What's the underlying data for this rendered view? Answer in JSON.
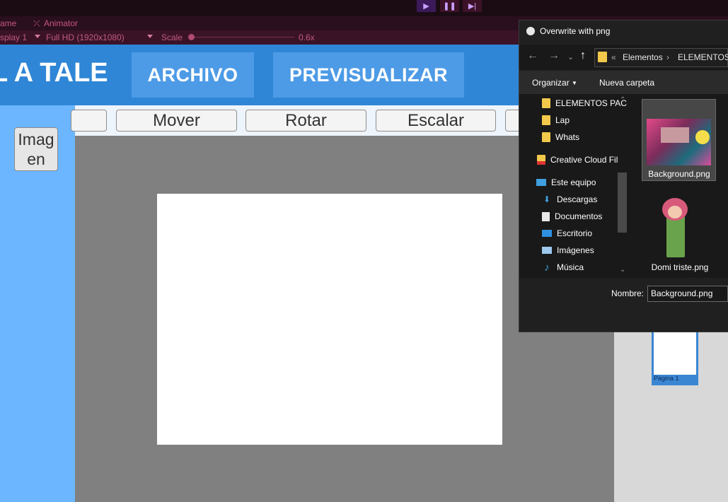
{
  "editor": {
    "tabs": [
      "ame",
      "Animator"
    ],
    "display": "splay 1",
    "resolution": "Full HD (1920x1080)",
    "scale_label": "Scale",
    "scale_value": "0.6x",
    "play_controls": [
      "play-icon",
      "pause-icon",
      "step-icon"
    ]
  },
  "app": {
    "title": "L A TALE",
    "archivo_label": "ARCHIVO",
    "preview_label": "PREVISUALIZAR",
    "image_button": "Imag en",
    "tools": [
      "Mover",
      "Rotar",
      "Escalar"
    ],
    "page_label": "Página 1"
  },
  "dialog": {
    "title": "Overwrite with png",
    "breadcrumb": [
      "Elementos",
      "ELEMENTOS P"
    ],
    "organize_label": "Organizar",
    "new_folder_label": "Nueva carpeta",
    "tree": [
      {
        "label": "ELEMENTOS PAC",
        "icon": "folder-icon"
      },
      {
        "label": "Lap",
        "icon": "folder-icon"
      },
      {
        "label": "Whats",
        "icon": "folder-icon"
      },
      {
        "label": "Creative Cloud Fil",
        "icon": "creative-cloud-folder-icon"
      },
      {
        "label": "Este equipo",
        "icon": "computer-icon"
      },
      {
        "label": "Descargas",
        "icon": "download-icon"
      },
      {
        "label": "Documentos",
        "icon": "document-icon"
      },
      {
        "label": "Escritorio",
        "icon": "desktop-icon"
      },
      {
        "label": "Imágenes",
        "icon": "pictures-icon"
      },
      {
        "label": "Música",
        "icon": "music-icon"
      }
    ],
    "files": [
      {
        "label": "Background.png"
      },
      {
        "label": "Domi triste.png"
      }
    ],
    "name_label": "Nombre:",
    "name_value": "Background.png"
  },
  "colors": {
    "header_blue": "#2f86d6",
    "button_blue": "#4d9be6",
    "left_panel": "#6bb6ff",
    "canvas_gray": "#808080"
  }
}
